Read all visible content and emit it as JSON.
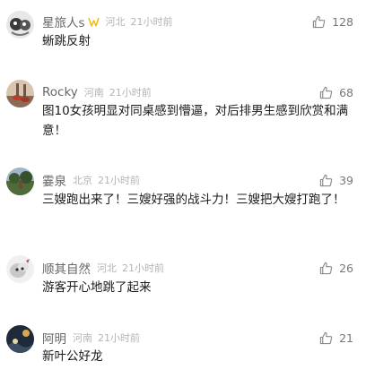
{
  "comments": [
    {
      "username": "星旅人s",
      "location": "河北",
      "time": "21小时前",
      "likes": "128",
      "text": "蜥跳反射",
      "has_badge": true
    },
    {
      "username": "Rocky",
      "location": "河南",
      "time": "21小时前",
      "likes": "68",
      "text": "图10女孩明显对同桌感到懵逼，对后排男生感到欣赏和满意！"
    },
    {
      "username": "霎泉",
      "location": "北京",
      "time": "21小时前",
      "likes": "39",
      "text": "三嫂跑出来了！三嫂好强的战斗力！三嫂把大嫂打跑了！"
    },
    {
      "username": "顺其自然",
      "location": "河北",
      "time": "21小时前",
      "likes": "26",
      "text": "游客开心地跳了起来"
    },
    {
      "username": "阿明",
      "location": "河南",
      "time": "21小时前",
      "likes": "21",
      "text": "新叶公好龙"
    }
  ],
  "icons": {
    "like": "thumbs-up-icon",
    "badge": "badge-icon"
  },
  "colors": {
    "username": "#666666",
    "meta": "#b4b4b4",
    "badge": "#f5b400",
    "text": "#1a1a1a"
  }
}
